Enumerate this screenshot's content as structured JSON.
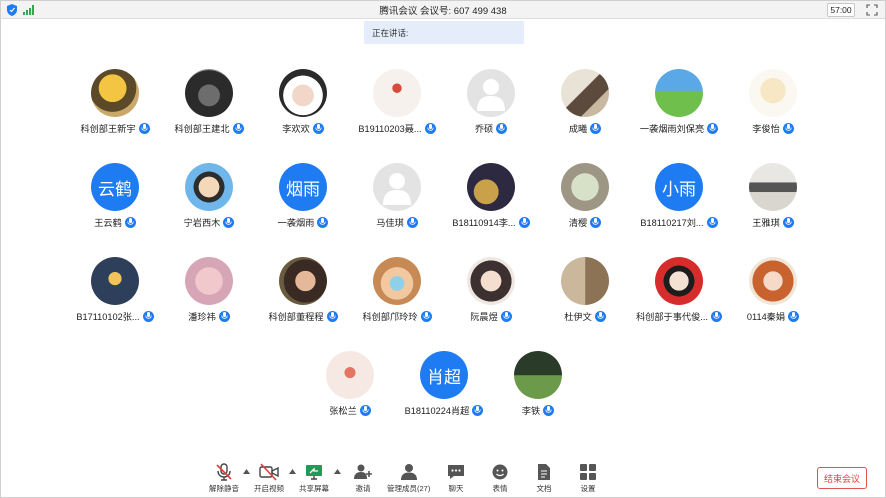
{
  "topbar": {
    "title": "腾讯会议 会议号: 607 499 438",
    "timer": "57:00"
  },
  "speaking_banner": "正在讲话:",
  "participants": [
    {
      "name": "科创部王新宇",
      "avatar": "photo-cartoon-yellow"
    },
    {
      "name": "科创部王建北",
      "avatar": "photo-dark"
    },
    {
      "name": "李欢欢",
      "avatar": "photo-panda-hat"
    },
    {
      "name": "B19110203聂...",
      "avatar": "photo-flower-red"
    },
    {
      "name": "乔硕",
      "avatar": "default-gray"
    },
    {
      "name": "成曦",
      "avatar": "photo-person"
    },
    {
      "name": "一袭烟雨刘保亮",
      "avatar": "photo-landscape"
    },
    {
      "name": "李俊怡",
      "avatar": "photo-anime-light"
    },
    {
      "name": "王云鹤",
      "avatar": "text",
      "text": "云鹤"
    },
    {
      "name": "宁岩西木",
      "avatar": "photo-cartoon-glasses"
    },
    {
      "name": "一袭烟雨",
      "avatar": "text",
      "text": "烟雨"
    },
    {
      "name": "马佳琪",
      "avatar": "default-gray"
    },
    {
      "name": "B18110914李...",
      "avatar": "photo-gold-animal"
    },
    {
      "name": "清樱",
      "avatar": "photo-plant"
    },
    {
      "name": "B18110217刘...",
      "avatar": "text",
      "text": "小雨"
    },
    {
      "name": "王雅琪",
      "avatar": "photo-person-light"
    },
    {
      "name": "B17110102张...",
      "avatar": "photo-night"
    },
    {
      "name": "潘珍祎",
      "avatar": "photo-pink-hair"
    },
    {
      "name": "科创部董程程",
      "avatar": "photo-girl-dark"
    },
    {
      "name": "科创部邝玲玲",
      "avatar": "photo-girl-mask"
    },
    {
      "name": "阮晨煜",
      "avatar": "photo-girl-light"
    },
    {
      "name": "杜伊文",
      "avatar": "photo-couple"
    },
    {
      "name": "科创部于事代俊...",
      "avatar": "photo-red-bg"
    },
    {
      "name": "0114秦娟",
      "avatar": "photo-orange-hair"
    },
    {
      "name": "张松兰",
      "avatar": "photo-dancer"
    },
    {
      "name": "B18110224肖超",
      "avatar": "text",
      "text": "肖超"
    },
    {
      "name": "李铁",
      "avatar": "photo-soccer"
    }
  ],
  "toolbar": {
    "items": [
      {
        "label": "解除静音",
        "icon": "mic-muted-icon"
      },
      {
        "label": "开启视频",
        "icon": "video-off-icon"
      },
      {
        "label": "共享屏幕",
        "icon": "share-screen-icon"
      },
      {
        "label": "邀请",
        "icon": "invite-icon"
      },
      {
        "label": "管理成员(27)",
        "icon": "members-icon"
      },
      {
        "label": "聊天",
        "icon": "chat-icon"
      },
      {
        "label": "表情",
        "icon": "emoji-icon"
      },
      {
        "label": "文档",
        "icon": "document-icon"
      },
      {
        "label": "设置",
        "icon": "settings-icon"
      }
    ],
    "end_label": "结束会议"
  }
}
